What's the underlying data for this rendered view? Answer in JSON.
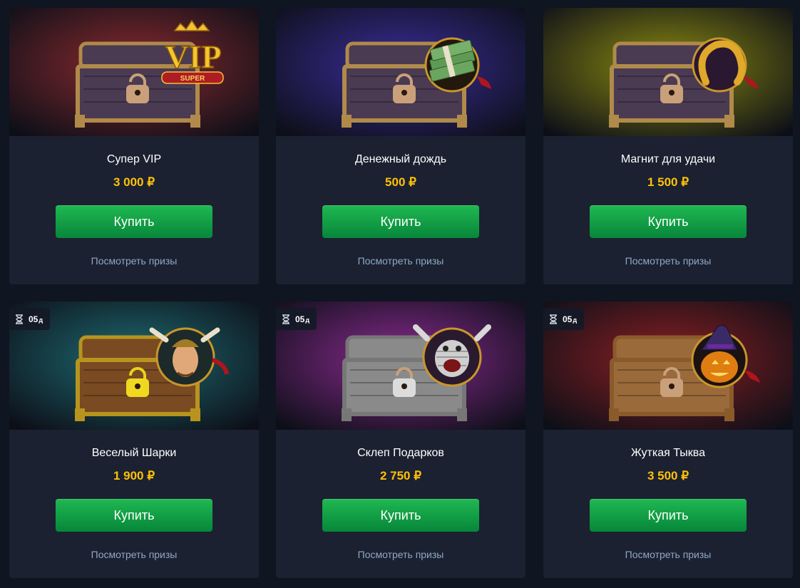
{
  "cards": [
    {
      "title": "Супер VIP",
      "price": "3 000 ₽",
      "buy_label": "Купить",
      "prizes_label": "Посмотреть призы",
      "timer": null,
      "bg": "#8a2a2e",
      "badge": "vip",
      "badge_text": "VIP",
      "badge_sub": "SUPER"
    },
    {
      "title": "Денежный дождь",
      "price": "500 ₽",
      "buy_label": "Купить",
      "prizes_label": "Посмотреть призы",
      "timer": null,
      "bg": "#3a2d9a",
      "badge": "money"
    },
    {
      "title": "Магнит для удачи",
      "price": "1 500 ₽",
      "buy_label": "Купить",
      "prizes_label": "Посмотреть призы",
      "timer": null,
      "bg": "#8a8a10",
      "badge": "horseshoe"
    },
    {
      "title": "Веселый Шарки",
      "price": "1 900 ₽",
      "buy_label": "Купить",
      "prizes_label": "Посмотреть призы",
      "timer": {
        "value": "05",
        "unit": "д"
      },
      "bg": "#1e6b72",
      "badge": "pirate"
    },
    {
      "title": "Склеп Подарков",
      "price": "2 750 ₽",
      "buy_label": "Купить",
      "prizes_label": "Посмотреть призы",
      "timer": {
        "value": "05",
        "unit": "д"
      },
      "bg": "#8a2a8f",
      "badge": "mummy"
    },
    {
      "title": "Жуткая Тыква",
      "price": "3 500 ₽",
      "buy_label": "Купить",
      "prizes_label": "Посмотреть призы",
      "timer": {
        "value": "05",
        "unit": "д"
      },
      "bg": "#8a1f22",
      "badge": "pumpkin"
    }
  ]
}
